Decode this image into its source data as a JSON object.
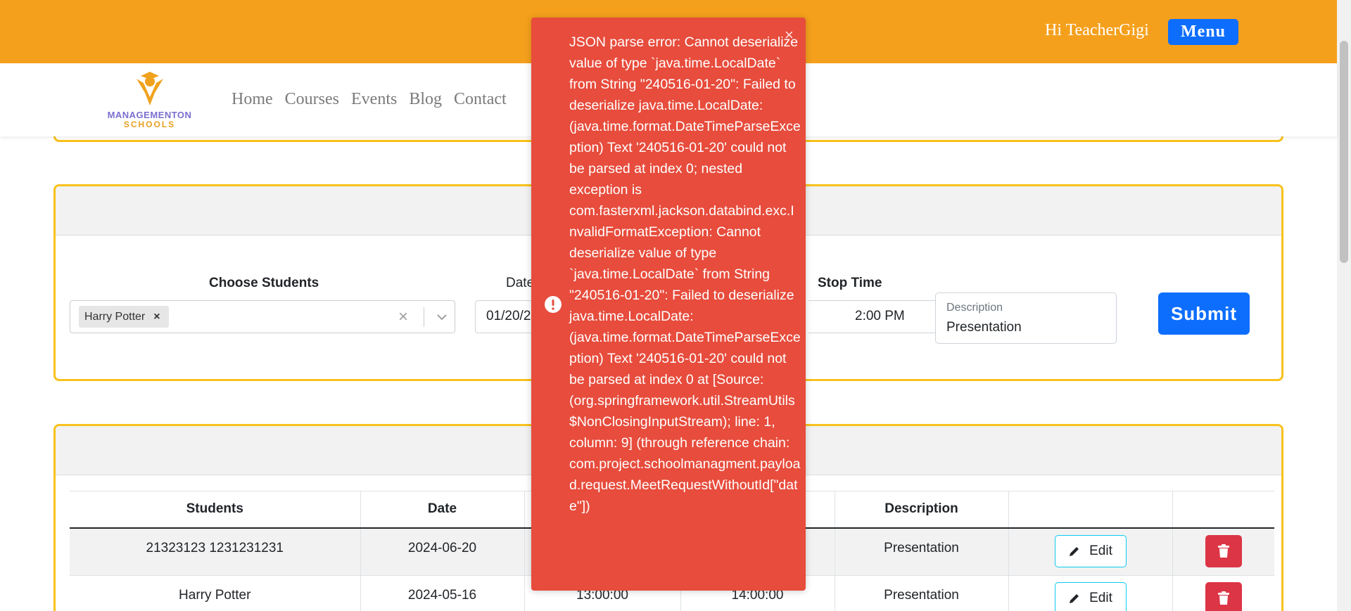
{
  "header": {
    "greeting": "Hi TeacherGigi",
    "menu_label": "Menu"
  },
  "brand": {
    "line1": "MANAGEMENTON",
    "line2": "SCHOOLS"
  },
  "nav": [
    "Home",
    "Courses",
    "Events",
    "Blog",
    "Contact"
  ],
  "form": {
    "students_label": "Choose Students",
    "selected_student": "Harry Potter",
    "date_label": "Date",
    "date_value": "01/20/2",
    "stop_label": "Stop Time",
    "stop_value": "2:00 PM",
    "description_label": "Description",
    "description_value": "Presentation",
    "submit_label": "Submit"
  },
  "table": {
    "headers": [
      "Students",
      "Date",
      "",
      "",
      "Description",
      "",
      ""
    ],
    "rows": [
      {
        "students": "21323123 1231231231",
        "date": "2024-06-20",
        "start": "",
        "stop": "",
        "description": "Presentation",
        "edit": "Edit"
      },
      {
        "students": "Harry Potter",
        "date": "2024-05-16",
        "start": "13:00:00",
        "stop": "14:00:00",
        "description": "Presentation",
        "edit": "Edit"
      }
    ]
  },
  "toast": {
    "message": "JSON parse error: Cannot deserialize value of type `java.time.LocalDate` from String \"240516-01-20\": Failed to deserialize java.time.LocalDate: (java.time.format.DateTimeParseException) Text '240516-01-20' could not be parsed at index 0; nested exception is com.fasterxml.jackson.databind.exc.InvalidFormatException: Cannot deserialize value of type `java.time.LocalDate` from String \"240516-01-20\": Failed to deserialize java.time.LocalDate: (java.time.format.DateTimeParseException) Text '240516-01-20' could not be parsed at index 0 at [Source: (org.springframework.util.StreamUtils$NonClosingInputStream); line: 1, column: 9] (through reference chain: com.project.schoolmanagment.payload.request.MeetRequestWithoutId[\"date\"])",
    "close_glyph": "×"
  },
  "icons": {
    "chip_remove": "×",
    "clear": "×"
  },
  "colors": {
    "topbar": "#f5a01c",
    "accent_blue": "#0d6efd",
    "panel_border": "#f9c11d",
    "toast_bg": "#e74c3c",
    "danger": "#dc3545"
  }
}
